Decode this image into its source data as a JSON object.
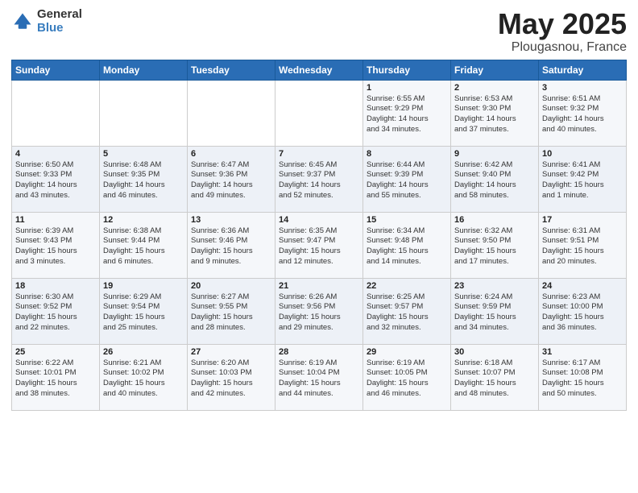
{
  "header": {
    "logo_general": "General",
    "logo_blue": "Blue",
    "month": "May 2025",
    "location": "Plougasnou, France"
  },
  "weekdays": [
    "Sunday",
    "Monday",
    "Tuesday",
    "Wednesday",
    "Thursday",
    "Friday",
    "Saturday"
  ],
  "weeks": [
    [
      {
        "day": "",
        "info": ""
      },
      {
        "day": "",
        "info": ""
      },
      {
        "day": "",
        "info": ""
      },
      {
        "day": "",
        "info": ""
      },
      {
        "day": "1",
        "info": "Sunrise: 6:55 AM\nSunset: 9:29 PM\nDaylight: 14 hours\nand 34 minutes."
      },
      {
        "day": "2",
        "info": "Sunrise: 6:53 AM\nSunset: 9:30 PM\nDaylight: 14 hours\nand 37 minutes."
      },
      {
        "day": "3",
        "info": "Sunrise: 6:51 AM\nSunset: 9:32 PM\nDaylight: 14 hours\nand 40 minutes."
      }
    ],
    [
      {
        "day": "4",
        "info": "Sunrise: 6:50 AM\nSunset: 9:33 PM\nDaylight: 14 hours\nand 43 minutes."
      },
      {
        "day": "5",
        "info": "Sunrise: 6:48 AM\nSunset: 9:35 PM\nDaylight: 14 hours\nand 46 minutes."
      },
      {
        "day": "6",
        "info": "Sunrise: 6:47 AM\nSunset: 9:36 PM\nDaylight: 14 hours\nand 49 minutes."
      },
      {
        "day": "7",
        "info": "Sunrise: 6:45 AM\nSunset: 9:37 PM\nDaylight: 14 hours\nand 52 minutes."
      },
      {
        "day": "8",
        "info": "Sunrise: 6:44 AM\nSunset: 9:39 PM\nDaylight: 14 hours\nand 55 minutes."
      },
      {
        "day": "9",
        "info": "Sunrise: 6:42 AM\nSunset: 9:40 PM\nDaylight: 14 hours\nand 58 minutes."
      },
      {
        "day": "10",
        "info": "Sunrise: 6:41 AM\nSunset: 9:42 PM\nDaylight: 15 hours\nand 1 minute."
      }
    ],
    [
      {
        "day": "11",
        "info": "Sunrise: 6:39 AM\nSunset: 9:43 PM\nDaylight: 15 hours\nand 3 minutes."
      },
      {
        "day": "12",
        "info": "Sunrise: 6:38 AM\nSunset: 9:44 PM\nDaylight: 15 hours\nand 6 minutes."
      },
      {
        "day": "13",
        "info": "Sunrise: 6:36 AM\nSunset: 9:46 PM\nDaylight: 15 hours\nand 9 minutes."
      },
      {
        "day": "14",
        "info": "Sunrise: 6:35 AM\nSunset: 9:47 PM\nDaylight: 15 hours\nand 12 minutes."
      },
      {
        "day": "15",
        "info": "Sunrise: 6:34 AM\nSunset: 9:48 PM\nDaylight: 15 hours\nand 14 minutes."
      },
      {
        "day": "16",
        "info": "Sunrise: 6:32 AM\nSunset: 9:50 PM\nDaylight: 15 hours\nand 17 minutes."
      },
      {
        "day": "17",
        "info": "Sunrise: 6:31 AM\nSunset: 9:51 PM\nDaylight: 15 hours\nand 20 minutes."
      }
    ],
    [
      {
        "day": "18",
        "info": "Sunrise: 6:30 AM\nSunset: 9:52 PM\nDaylight: 15 hours\nand 22 minutes."
      },
      {
        "day": "19",
        "info": "Sunrise: 6:29 AM\nSunset: 9:54 PM\nDaylight: 15 hours\nand 25 minutes."
      },
      {
        "day": "20",
        "info": "Sunrise: 6:27 AM\nSunset: 9:55 PM\nDaylight: 15 hours\nand 28 minutes."
      },
      {
        "day": "21",
        "info": "Sunrise: 6:26 AM\nSunset: 9:56 PM\nDaylight: 15 hours\nand 29 minutes."
      },
      {
        "day": "22",
        "info": "Sunrise: 6:25 AM\nSunset: 9:57 PM\nDaylight: 15 hours\nand 32 minutes."
      },
      {
        "day": "23",
        "info": "Sunrise: 6:24 AM\nSunset: 9:59 PM\nDaylight: 15 hours\nand 34 minutes."
      },
      {
        "day": "24",
        "info": "Sunrise: 6:23 AM\nSunset: 10:00 PM\nDaylight: 15 hours\nand 36 minutes."
      }
    ],
    [
      {
        "day": "25",
        "info": "Sunrise: 6:22 AM\nSunset: 10:01 PM\nDaylight: 15 hours\nand 38 minutes."
      },
      {
        "day": "26",
        "info": "Sunrise: 6:21 AM\nSunset: 10:02 PM\nDaylight: 15 hours\nand 40 minutes."
      },
      {
        "day": "27",
        "info": "Sunrise: 6:20 AM\nSunset: 10:03 PM\nDaylight: 15 hours\nand 42 minutes."
      },
      {
        "day": "28",
        "info": "Sunrise: 6:19 AM\nSunset: 10:04 PM\nDaylight: 15 hours\nand 44 minutes."
      },
      {
        "day": "29",
        "info": "Sunrise: 6:19 AM\nSunset: 10:05 PM\nDaylight: 15 hours\nand 46 minutes."
      },
      {
        "day": "30",
        "info": "Sunrise: 6:18 AM\nSunset: 10:07 PM\nDaylight: 15 hours\nand 48 minutes."
      },
      {
        "day": "31",
        "info": "Sunrise: 6:17 AM\nSunset: 10:08 PM\nDaylight: 15 hours\nand 50 minutes."
      }
    ]
  ]
}
